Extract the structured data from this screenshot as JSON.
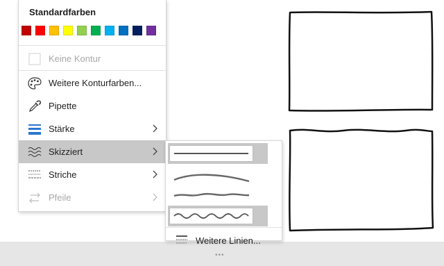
{
  "menu": {
    "title": "Standardfarben",
    "standard_colors": [
      "#c00000",
      "#ff0000",
      "#ffc000",
      "#ffff00",
      "#92d050",
      "#00b050",
      "#00b0f0",
      "#0070c0",
      "#002060",
      "#7030a0"
    ],
    "items": [
      {
        "label": "Keine Kontur",
        "icon": "no-outline-icon",
        "enabled": false
      },
      {
        "label": "Weitere Konturfarben...",
        "icon": "palette-icon",
        "enabled": true
      },
      {
        "label": "Pipette",
        "icon": "eyedropper-icon",
        "enabled": true
      },
      {
        "label": "Stärke",
        "icon": "line-weight-icon",
        "enabled": true,
        "submenu": true
      },
      {
        "label": "Skizziert",
        "icon": "sketched-icon",
        "enabled": true,
        "submenu": true,
        "highlighted": true
      },
      {
        "label": "Striche",
        "icon": "dashes-icon",
        "enabled": true,
        "submenu": true
      },
      {
        "label": "Pfeile",
        "icon": "arrows-icon",
        "enabled": false,
        "submenu": true
      }
    ]
  },
  "sketched_submenu": {
    "styles": [
      "straight",
      "curved",
      "freehand",
      "scribble"
    ],
    "selected_style": "scribble",
    "more_label": "Weitere Linien..."
  },
  "accent_colors": {
    "highlight": "#c8c8c8",
    "line_blue": "#2b78d0"
  }
}
